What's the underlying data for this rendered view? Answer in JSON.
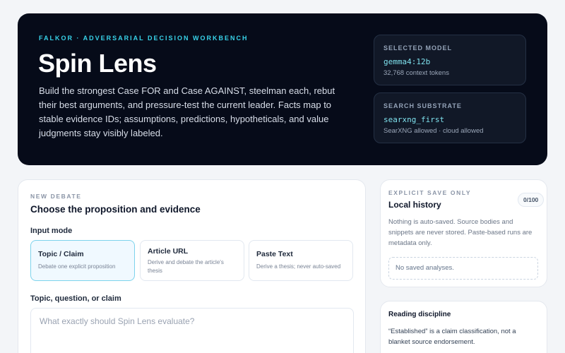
{
  "hero": {
    "eyebrow": "FALKOR · ADVERSARIAL DECISION WORKBENCH",
    "title": "Spin Lens",
    "description": "Build the strongest Case FOR and Case AGAINST, steelman each, rebut their best arguments, and pressure-test the current leader. Facts map to stable evidence IDs; assumptions, predictions, hypotheticals, and value judgments stay visibly labeled."
  },
  "model": {
    "label": "SELECTED MODEL",
    "value": "gemma4:12b",
    "sub": "32,768 context tokens"
  },
  "search": {
    "label": "SEARCH SUBSTRATE",
    "value": "searxng_first",
    "sub": "SearXNG allowed · cloud allowed"
  },
  "debate": {
    "kicker": "NEW DEBATE",
    "title": "Choose the proposition and evidence",
    "input_mode_label": "Input mode",
    "modes": [
      {
        "title": "Topic / Claim",
        "desc": "Debate one explicit proposition",
        "active": true
      },
      {
        "title": "Article URL",
        "desc": "Derive and debate the article's thesis",
        "active": false
      },
      {
        "title": "Paste Text",
        "desc": "Derive a thesis; never auto-saved",
        "active": false
      }
    ],
    "topic_label": "Topic, question, or claim",
    "topic_placeholder": "What exactly should Spin Lens evaluate?",
    "topic_value": ""
  },
  "history": {
    "kicker": "EXPLICIT SAVE ONLY",
    "title": "Local history",
    "count": "0/100",
    "description": "Nothing is auto-saved. Source bodies and snippets are never stored. Paste-based runs are metadata only.",
    "empty": "No saved analyses."
  },
  "reading": {
    "title": "Reading discipline",
    "text": "“Established” is a claim classification, not a blanket source endorsement."
  }
}
